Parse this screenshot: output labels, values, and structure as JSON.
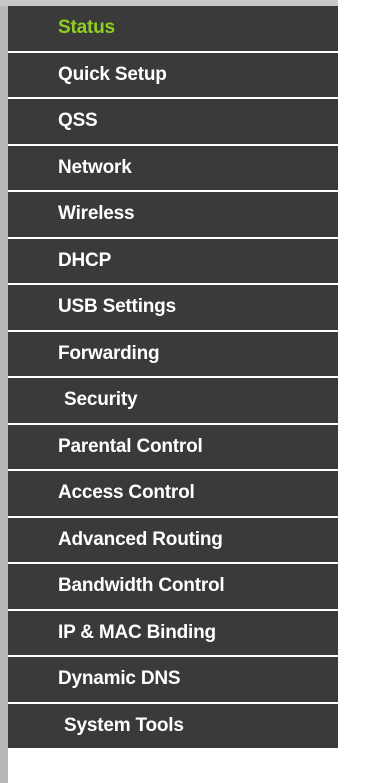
{
  "menu": {
    "active_color": "#8fcf1e",
    "background_color": "#3a3a3a",
    "items": [
      {
        "label": "Status",
        "active": true
      },
      {
        "label": "Quick Setup",
        "active": false
      },
      {
        "label": "QSS",
        "active": false
      },
      {
        "label": "Network",
        "active": false
      },
      {
        "label": "Wireless",
        "active": false
      },
      {
        "label": "DHCP",
        "active": false
      },
      {
        "label": "USB Settings",
        "active": false
      },
      {
        "label": "Forwarding",
        "active": false
      },
      {
        "label": "Security",
        "active": false
      },
      {
        "label": "Parental Control",
        "active": false
      },
      {
        "label": "Access Control",
        "active": false
      },
      {
        "label": "Advanced Routing",
        "active": false
      },
      {
        "label": "Bandwidth Control",
        "active": false
      },
      {
        "label": "IP & MAC Binding",
        "active": false
      },
      {
        "label": "Dynamic DNS",
        "active": false
      },
      {
        "label": "System Tools",
        "active": false
      }
    ]
  }
}
